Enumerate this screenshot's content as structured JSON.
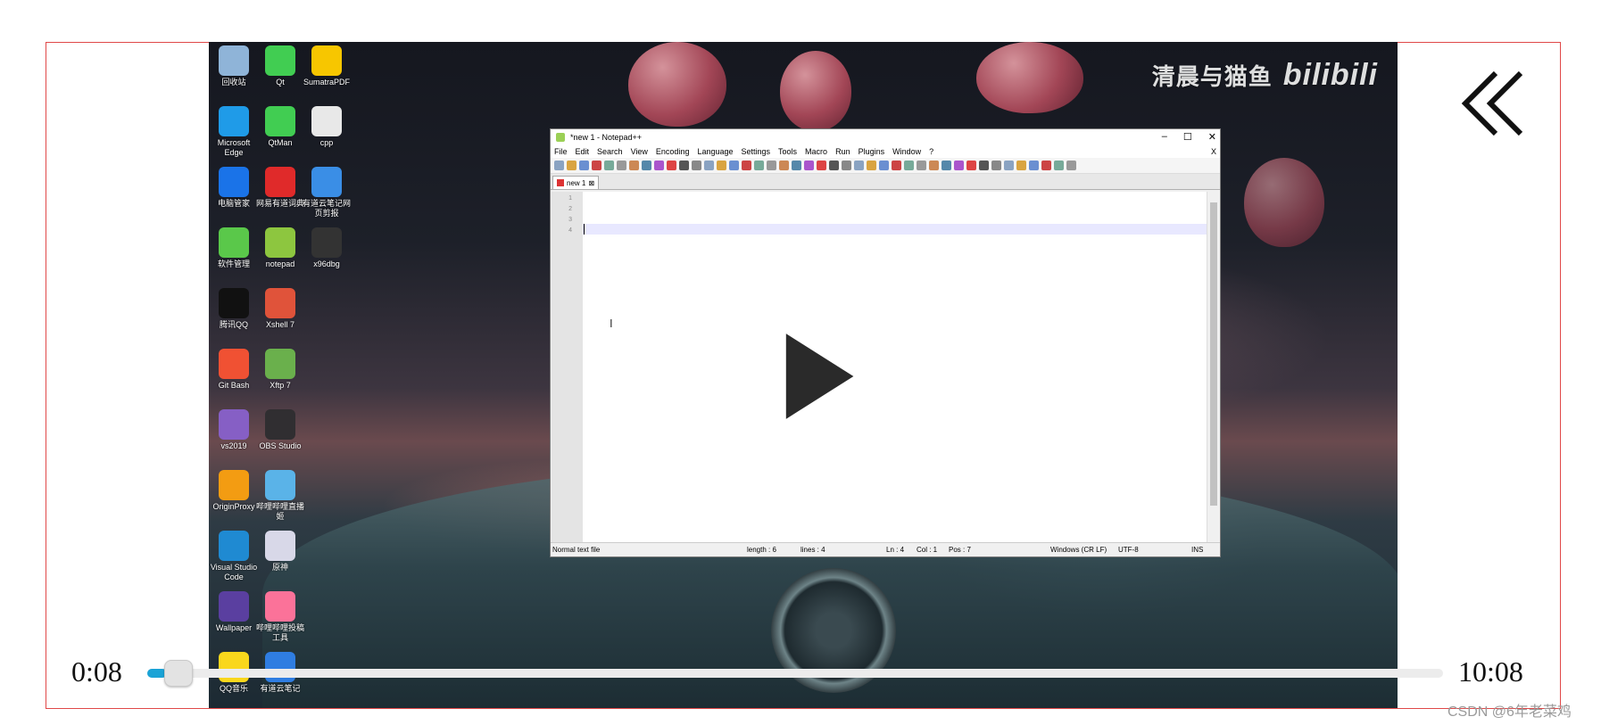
{
  "player": {
    "current_time": "0:08",
    "total_time": "10:08",
    "progress": 0.0132,
    "accent_color": "#1aa3d6",
    "play_icon": "play-icon",
    "back_icon": "double-chevron-left-icon"
  },
  "watermark": {
    "text": "清晨与猫鱼",
    "brand": "bilibili"
  },
  "csdn_watermark": "CSDN @6年老菜鸡",
  "desktop_icons": [
    {
      "label": "回收站",
      "color": "#8fb4d8"
    },
    {
      "label": "Qt",
      "color": "#41cd52"
    },
    {
      "label": "SumatraPDF",
      "color": "#f7c600"
    },
    {
      "label": "Microsoft Edge",
      "color": "#1f9be8"
    },
    {
      "label": "QtMan",
      "color": "#41cd52"
    },
    {
      "label": "cpp",
      "color": "#e8e8e8"
    },
    {
      "label": "电脑管家",
      "color": "#1a73e8"
    },
    {
      "label": "网易有道词典",
      "color": "#e02a2a"
    },
    {
      "label": "有道云笔记网页剪报",
      "color": "#3a8ee6"
    },
    {
      "label": "软件管理",
      "color": "#5ac84a"
    },
    {
      "label": "notepad",
      "color": "#8dc63f"
    },
    {
      "label": "x96dbg",
      "color": "#333333"
    },
    {
      "label": "腾讯QQ",
      "color": "#111111"
    },
    {
      "label": "Xshell 7",
      "color": "#e0533a"
    },
    {
      "label": "Git Bash",
      "color": "#f05133"
    },
    {
      "label": "Xftp 7",
      "color": "#6ab04c"
    },
    {
      "label": "vs2019",
      "color": "#865fc5"
    },
    {
      "label": "OBS Studio",
      "color": "#302e31"
    },
    {
      "label": "OriginProxy",
      "color": "#f39c12"
    },
    {
      "label": "哔哩哔哩直播姬",
      "color": "#5ab3e8"
    },
    {
      "label": "Visual Studio Code",
      "color": "#1f8ad2"
    },
    {
      "label": "原神",
      "color": "#d8d8e8"
    },
    {
      "label": "Wallpaper",
      "color": "#5a3fa0"
    },
    {
      "label": "哔哩哔哩投稿工具",
      "color": "#fb7299"
    },
    {
      "label": "QQ音乐",
      "color": "#f9d71c"
    },
    {
      "label": "有道云笔记",
      "color": "#2f7de1"
    }
  ],
  "notepad": {
    "title": "*new 1 - Notepad++",
    "menu": [
      "File",
      "Edit",
      "Search",
      "View",
      "Encoding",
      "Language",
      "Settings",
      "Tools",
      "Macro",
      "Run",
      "Plugins",
      "Window",
      "?"
    ],
    "menu_close": "X",
    "tab_label": "new 1",
    "line_numbers": [
      "1",
      "2",
      "3",
      "4"
    ],
    "status": {
      "file_type": "Normal text file",
      "length": "length : 6",
      "lines": "lines : 4",
      "ln": "Ln : 4",
      "col": "Col : 1",
      "pos": "Pos : 7",
      "eol": "Windows (CR LF)",
      "encoding": "UTF-8",
      "mode": "INS"
    }
  }
}
